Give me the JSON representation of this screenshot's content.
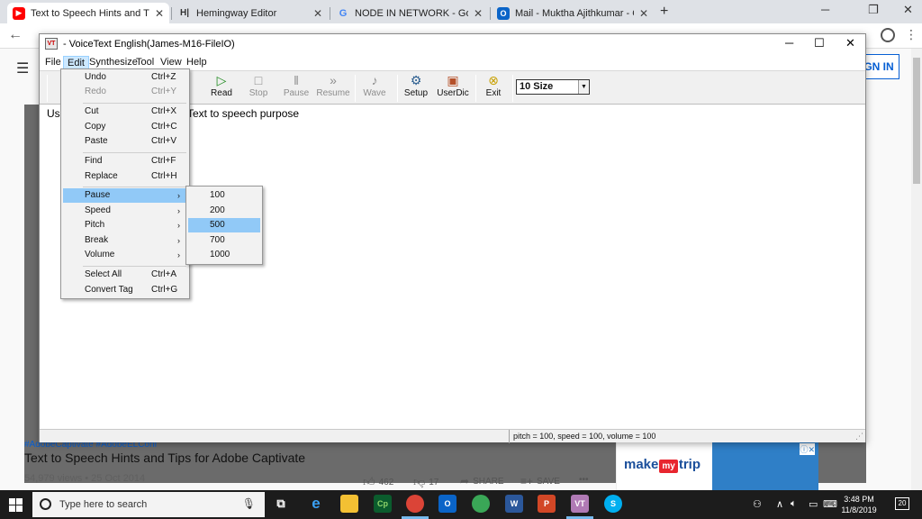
{
  "browser": {
    "tabs": [
      {
        "title": "Text to Speech Hints and Tips for Ad",
        "icon": "youtube-icon",
        "color": "#ff0000",
        "glyph": "▶"
      },
      {
        "title": "Hemingway Editor",
        "icon": "hemingway-icon",
        "color": "#333333",
        "glyph": "H|"
      },
      {
        "title": "NODE IN NETWORK - Google Se",
        "icon": "google-icon",
        "color": "#4285f4",
        "glyph": "G"
      },
      {
        "title": "Mail - Muktha Ajithkumar - Outlo",
        "icon": "outlook-icon",
        "color": "#0a64c8",
        "glyph": "O"
      }
    ],
    "tab_close": "✕",
    "new_tab": "+",
    "window_controls": {
      "minimize": "─",
      "restore": "❐",
      "close": "✕"
    }
  },
  "youtube": {
    "sign_in": "GN IN",
    "tags": "#AdobeCaptivate #AdobeELConf",
    "video_title": "Text to Speech Hints and Tips for Adobe Captivate",
    "views": "54,979 views • 25 Oct 2014",
    "likes": "462",
    "dislikes": "17",
    "share": "SHARE",
    "save": "SAVE",
    "more": "•••",
    "ad": {
      "brand_left": "make",
      "brand_my": "my",
      "brand_right": "trip",
      "close": "ⓘ✕"
    }
  },
  "app": {
    "title": "- VoiceText English(James-M16-FileIO)",
    "menus": [
      "File",
      "Edit",
      "Synthesize",
      "Tool",
      "View",
      "Help"
    ],
    "toolbar": [
      {
        "label": "Read",
        "glyph": "▷",
        "enabled": true,
        "icon": "play-icon"
      },
      {
        "label": "Stop",
        "glyph": "□",
        "enabled": false,
        "icon": "stop-icon"
      },
      {
        "label": "Pause",
        "glyph": "‖",
        "enabled": false,
        "icon": "pause-icon"
      },
      {
        "label": "Resume",
        "glyph": "»",
        "enabled": false,
        "icon": "resume-icon"
      },
      {
        "label": "Wave",
        "glyph": "♪",
        "enabled": false,
        "icon": "wave-icon"
      },
      {
        "label": "Setup",
        "glyph": "⚙",
        "enabled": true,
        "icon": "setup-icon"
      },
      {
        "label": "UserDic",
        "glyph": "▣",
        "enabled": true,
        "icon": "dictionary-icon"
      },
      {
        "label": "Exit",
        "glyph": "⊗",
        "enabled": true,
        "icon": "exit-icon"
      }
    ],
    "font_size": "10 Size",
    "editor_prefix": "Us",
    "editor_text": "Text to speech purpose",
    "status": "pitch = 100, speed = 100, volume = 100",
    "edit_menu": [
      {
        "label": "Undo",
        "shortcut": "Ctrl+Z",
        "enabled": true
      },
      {
        "label": "Redo",
        "shortcut": "Ctrl+Y",
        "enabled": false
      },
      {
        "label": "Cut",
        "shortcut": "Ctrl+X",
        "enabled": true
      },
      {
        "label": "Copy",
        "shortcut": "Ctrl+C",
        "enabled": true
      },
      {
        "label": "Paste",
        "shortcut": "Ctrl+V",
        "enabled": true
      },
      {
        "label": "Find",
        "shortcut": "Ctrl+F",
        "enabled": true
      },
      {
        "label": "Replace",
        "shortcut": "Ctrl+H",
        "enabled": true
      },
      {
        "label": "Pause",
        "submenu": true,
        "highlighted": true
      },
      {
        "label": "Speed",
        "submenu": true
      },
      {
        "label": "Pitch",
        "submenu": true
      },
      {
        "label": "Break",
        "submenu": true
      },
      {
        "label": "Volume",
        "submenu": true
      },
      {
        "label": "Select All",
        "shortcut": "Ctrl+A",
        "enabled": true
      },
      {
        "label": "Convert Tag",
        "shortcut": "Ctrl+G",
        "enabled": true
      }
    ],
    "pause_submenu": [
      "100",
      "200",
      "500",
      "700",
      "1000"
    ],
    "pause_selected": "500"
  },
  "taskbar": {
    "search_placeholder": "Type here to search",
    "apps": [
      {
        "name": "task-view",
        "glyph": "⧉",
        "color": "#1c1c1c"
      },
      {
        "name": "edge",
        "glyph": "e",
        "color": "#0078d7"
      },
      {
        "name": "file-explorer",
        "glyph": "▬",
        "color": "#f3c033"
      },
      {
        "name": "captivate",
        "glyph": "Cp",
        "color": "#0b5c2d"
      },
      {
        "name": "chrome",
        "glyph": "◉",
        "color": "#db4437"
      },
      {
        "name": "outlook",
        "glyph": "O",
        "color": "#0a64c8"
      },
      {
        "name": "chrome-2",
        "glyph": "◉",
        "color": "#3aa757"
      },
      {
        "name": "word",
        "glyph": "W",
        "color": "#2b579a"
      },
      {
        "name": "powerpoint",
        "glyph": "P",
        "color": "#d24726"
      },
      {
        "name": "voicetext",
        "glyph": "VT",
        "color": "#b07ab5"
      },
      {
        "name": "skype",
        "glyph": "S",
        "color": "#00aff0"
      }
    ],
    "time": "3:48 PM",
    "date": "11/8/2019",
    "notifications": "20"
  }
}
